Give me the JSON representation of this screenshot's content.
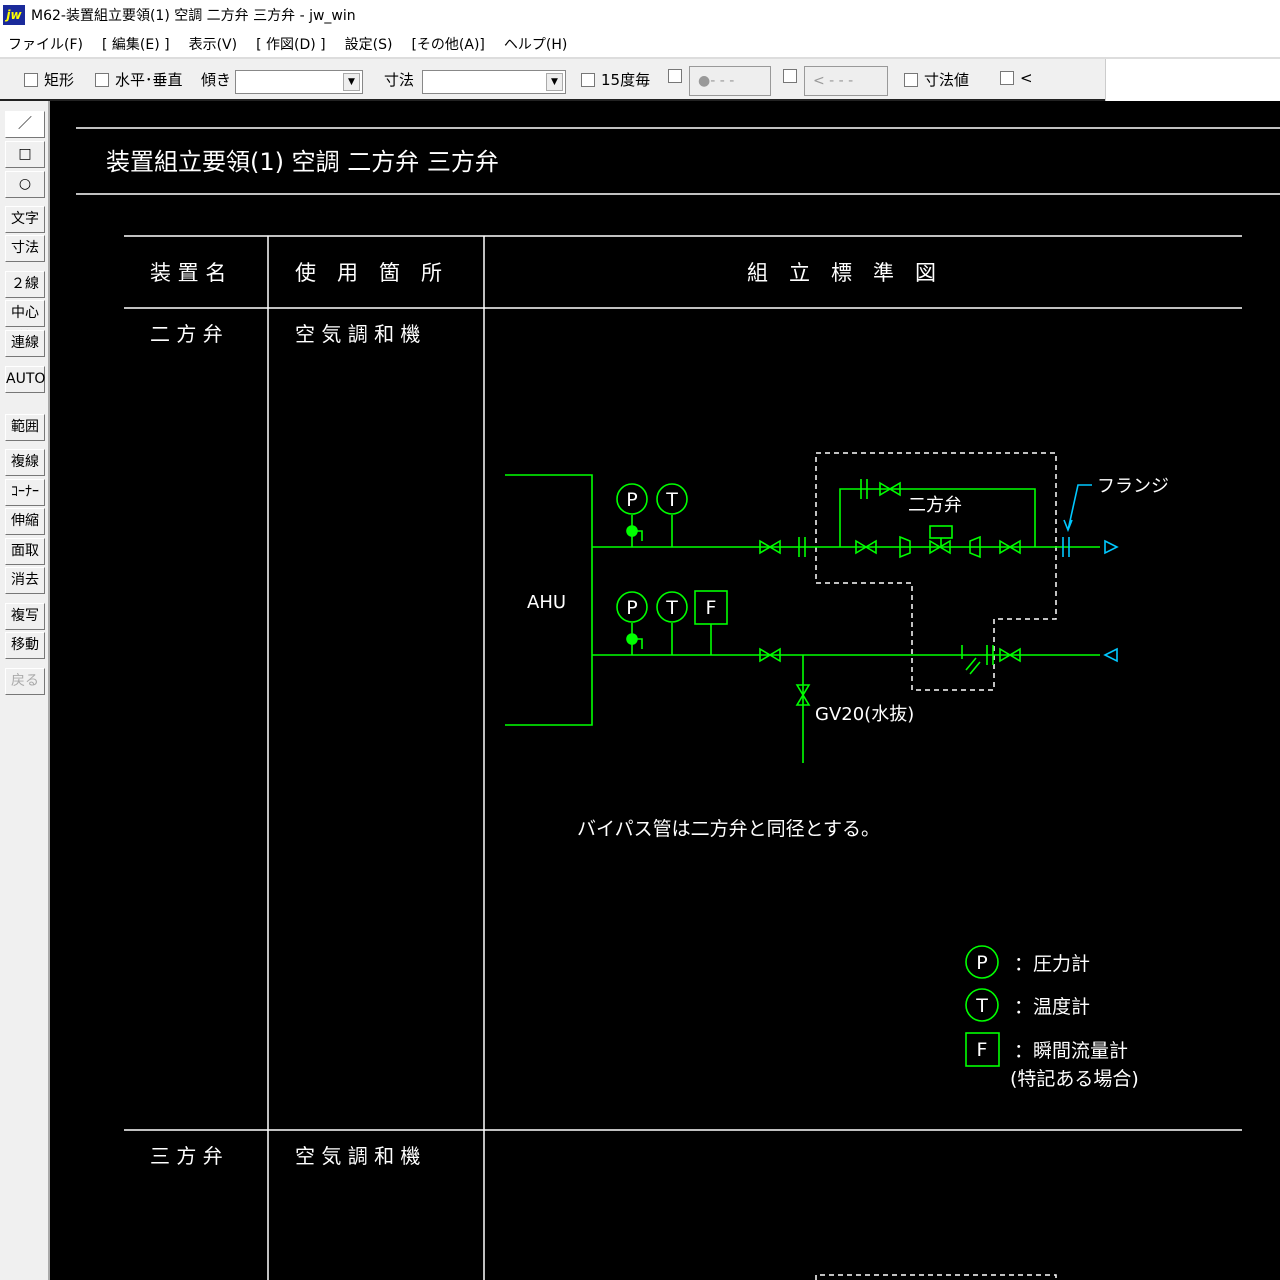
{
  "window": {
    "logo": "jw",
    "title": "M62-装置組立要領(1) 空調 二方弁 三方弁 - jw_win"
  },
  "menu": [
    "ファイル(F)",
    "[ 編集(E) ]",
    "表示(V)",
    "[ 作図(D) ]",
    "設定(S)",
    "[その他(A)]",
    "ヘルプ(H)"
  ],
  "toolbar": {
    "rect": "矩形",
    "hv": "水平･垂直",
    "tilt": "傾き",
    "tilt_value": "",
    "dim": "寸法",
    "dim_value": "",
    "deg15": "15度毎",
    "btn1": "●- - -",
    "btn2": "< - - -",
    "dimval": "寸法値",
    "lt": "<"
  },
  "left_tools": [
    "／",
    "□",
    "○",
    "文字",
    "寸法",
    "２線",
    "中心線",
    "連線",
    "AUTO",
    "範囲",
    "複線",
    "ｺｰﾅｰ",
    "伸縮",
    "面取",
    "消去",
    "複写",
    "移動",
    "戻る"
  ],
  "drawing": {
    "title": "装置組立要領(1) 空調 二方弁 三方弁",
    "headers": [
      "装 置 名",
      "使　用　箇　所",
      "組　立　標　準　図"
    ],
    "rows": [
      {
        "name": "二 方 弁",
        "place": "空 気 調 和 機"
      },
      {
        "name": "三 方 弁",
        "place": "空 気 調 和 機"
      }
    ],
    "ahu": "AHU",
    "p": "P",
    "t": "T",
    "f": "F",
    "valve_label": "二方弁",
    "flange_label": "フランジ",
    "drain_label": "GV20(水抜)",
    "note": "バイパス管は二方弁と同径とする。",
    "legend": [
      {
        "symbol": "P",
        "text": "：圧力計"
      },
      {
        "symbol": "T",
        "text": "：温度計"
      },
      {
        "symbol": "F",
        "text": "：瞬間流量計"
      }
    ],
    "legend_note": "(特記ある場合)"
  },
  "colors": {
    "line": "#ffffff",
    "pipe": "#00ff00",
    "flange": "#00c8ff",
    "background": "#000000"
  }
}
